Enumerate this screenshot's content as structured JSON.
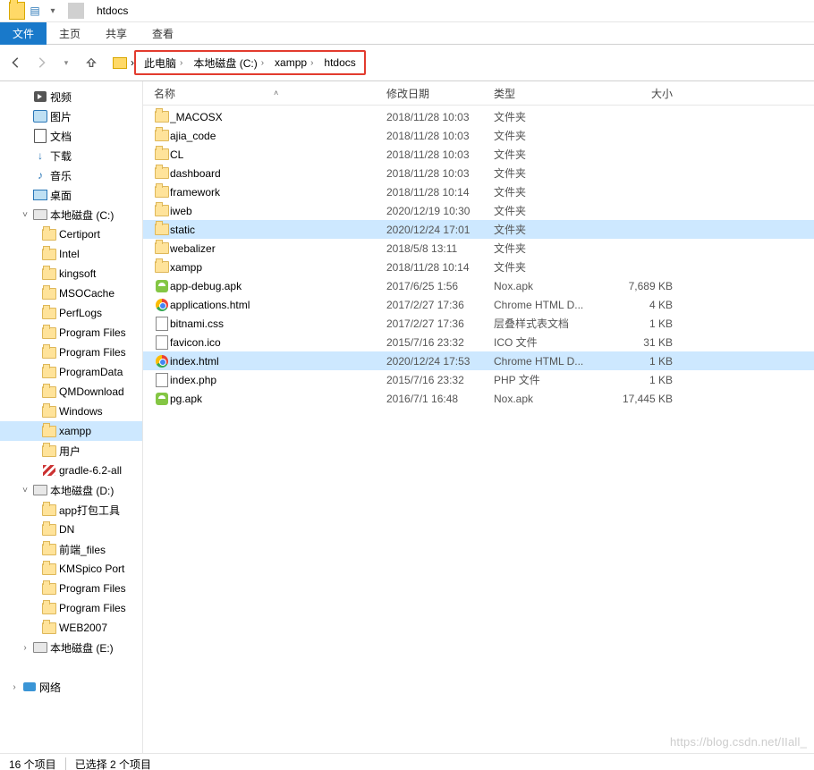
{
  "window": {
    "title": "htdocs"
  },
  "tabs": {
    "file": "文件",
    "home": "主页",
    "share": "共享",
    "view": "查看"
  },
  "breadcrumb": [
    "此电脑",
    "本地磁盘 (C:)",
    "xampp",
    "htdocs"
  ],
  "columns": {
    "name": "名称",
    "date": "修改日期",
    "type": "类型",
    "size": "大小"
  },
  "nav": [
    {
      "label": "视频",
      "icon": "video",
      "indent": 1
    },
    {
      "label": "图片",
      "icon": "pic",
      "indent": 1
    },
    {
      "label": "文档",
      "icon": "doc",
      "indent": 1
    },
    {
      "label": "下载",
      "icon": "dl",
      "indent": 1
    },
    {
      "label": "音乐",
      "icon": "music",
      "indent": 1
    },
    {
      "label": "桌面",
      "icon": "desktop",
      "indent": 1
    },
    {
      "label": "本地磁盘 (C:)",
      "icon": "drive",
      "indent": 1,
      "expander": "v"
    },
    {
      "label": "Certiport",
      "icon": "folder",
      "indent": 2
    },
    {
      "label": "Intel",
      "icon": "folder",
      "indent": 2
    },
    {
      "label": "kingsoft",
      "icon": "folder",
      "indent": 2
    },
    {
      "label": "MSOCache",
      "icon": "folder",
      "indent": 2
    },
    {
      "label": "PerfLogs",
      "icon": "folder",
      "indent": 2
    },
    {
      "label": "Program Files",
      "icon": "folder",
      "indent": 2
    },
    {
      "label": "Program Files",
      "icon": "folder",
      "indent": 2
    },
    {
      "label": "ProgramData",
      "icon": "folder",
      "indent": 2
    },
    {
      "label": "QMDownload",
      "icon": "folder",
      "indent": 2
    },
    {
      "label": "Windows",
      "icon": "folder",
      "indent": 2
    },
    {
      "label": "xampp",
      "icon": "folder",
      "indent": 2,
      "selected": true
    },
    {
      "label": "用户",
      "icon": "folder",
      "indent": 2
    },
    {
      "label": "gradle-6.2-all",
      "icon": "archive",
      "indent": 2
    },
    {
      "label": "本地磁盘 (D:)",
      "icon": "drive",
      "indent": 1,
      "expander": "v"
    },
    {
      "label": "app打包工具",
      "icon": "folder",
      "indent": 2
    },
    {
      "label": "DN",
      "icon": "folder",
      "indent": 2
    },
    {
      "label": "前端_files",
      "icon": "folder",
      "indent": 2
    },
    {
      "label": "KMSpico Port",
      "icon": "folder",
      "indent": 2
    },
    {
      "label": "Program Files",
      "icon": "folder",
      "indent": 2
    },
    {
      "label": "Program Files",
      "icon": "folder",
      "indent": 2
    },
    {
      "label": "WEB2007",
      "icon": "folder",
      "indent": 2
    },
    {
      "label": "本地磁盘 (E:)",
      "icon": "drive",
      "indent": 1,
      "expander": ">"
    },
    {
      "label": "",
      "icon": "",
      "indent": 0,
      "blank": true
    },
    {
      "label": "网络",
      "icon": "net",
      "indent": 0,
      "expander": ">"
    }
  ],
  "files": [
    {
      "name": "_MACOSX",
      "date": "2018/11/28 10:03",
      "type": "文件夹",
      "size": "",
      "icon": "folder"
    },
    {
      "name": "ajia_code",
      "date": "2018/11/28 10:03",
      "type": "文件夹",
      "size": "",
      "icon": "folder"
    },
    {
      "name": "CL",
      "date": "2018/11/28 10:03",
      "type": "文件夹",
      "size": "",
      "icon": "folder"
    },
    {
      "name": "dashboard",
      "date": "2018/11/28 10:03",
      "type": "文件夹",
      "size": "",
      "icon": "folder"
    },
    {
      "name": "framework",
      "date": "2018/11/28 10:14",
      "type": "文件夹",
      "size": "",
      "icon": "folder"
    },
    {
      "name": "iweb",
      "date": "2020/12/19 10:30",
      "type": "文件夹",
      "size": "",
      "icon": "folder"
    },
    {
      "name": "static",
      "date": "2020/12/24 17:01",
      "type": "文件夹",
      "size": "",
      "icon": "folder",
      "selected": true
    },
    {
      "name": "webalizer",
      "date": "2018/5/8 13:11",
      "type": "文件夹",
      "size": "",
      "icon": "folder"
    },
    {
      "name": "xampp",
      "date": "2018/11/28 10:14",
      "type": "文件夹",
      "size": "",
      "icon": "folder"
    },
    {
      "name": "app-debug.apk",
      "date": "2017/6/25 1:56",
      "type": "Nox.apk",
      "size": "7,689 KB",
      "icon": "apk"
    },
    {
      "name": "applications.html",
      "date": "2017/2/27 17:36",
      "type": "Chrome HTML D...",
      "size": "4 KB",
      "icon": "chrome"
    },
    {
      "name": "bitnami.css",
      "date": "2017/2/27 17:36",
      "type": "层叠样式表文档",
      "size": "1 KB",
      "icon": "css"
    },
    {
      "name": "favicon.ico",
      "date": "2015/7/16 23:32",
      "type": "ICO 文件",
      "size": "31 KB",
      "icon": "ico"
    },
    {
      "name": "index.html",
      "date": "2020/12/24 17:53",
      "type": "Chrome HTML D...",
      "size": "1 KB",
      "icon": "chrome",
      "selected": true
    },
    {
      "name": "index.php",
      "date": "2015/7/16 23:32",
      "type": "PHP 文件",
      "size": "1 KB",
      "icon": "php"
    },
    {
      "name": "pg.apk",
      "date": "2016/7/1 16:48",
      "type": "Nox.apk",
      "size": "17,445 KB",
      "icon": "apk"
    }
  ],
  "status": {
    "items": "16 个项目",
    "selected": "已选择 2 个项目"
  },
  "watermark": "https://blog.csdn.net/IIall_"
}
